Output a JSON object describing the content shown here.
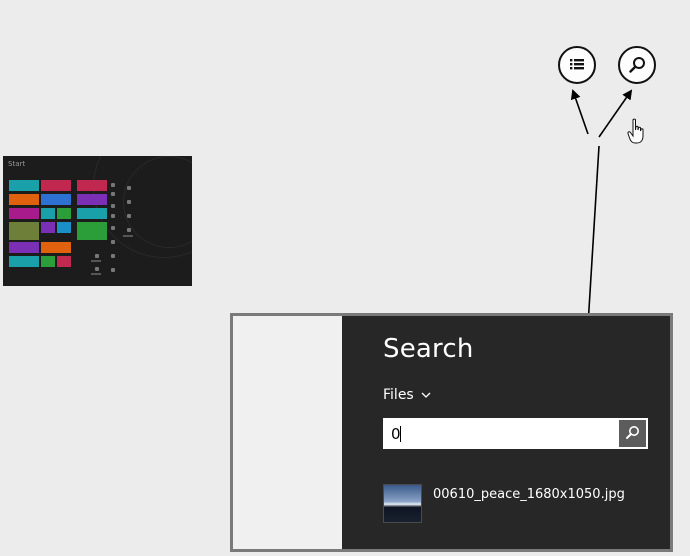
{
  "start_thumbnail": {
    "label": "Start",
    "tiles_left": [
      "#1aa0a8",
      "#c02850",
      "#e0620f",
      "#2d72d2",
      "#a81b8c",
      "#1aa0a8",
      "#2b9e3a",
      "#1a8fc8",
      "#7b2fb5",
      "#e0620f",
      "#1aa0a8",
      "#2b9e3a",
      "#c02850"
    ],
    "tiles_right": [
      "#c02850",
      "#7b2fb5",
      "#1aa0a8",
      "#2b9e3a"
    ]
  },
  "charms": {
    "list_icon": "list-icon",
    "search_icon": "search-icon"
  },
  "search_pane": {
    "title": "Search",
    "scope_label": "Files",
    "query": "0",
    "result_name": "00610_peace_1680x1050.jpg"
  },
  "colors": {
    "pane_bg": "#272727",
    "frame": "#7a7a7a",
    "page_bg": "#ececec"
  }
}
